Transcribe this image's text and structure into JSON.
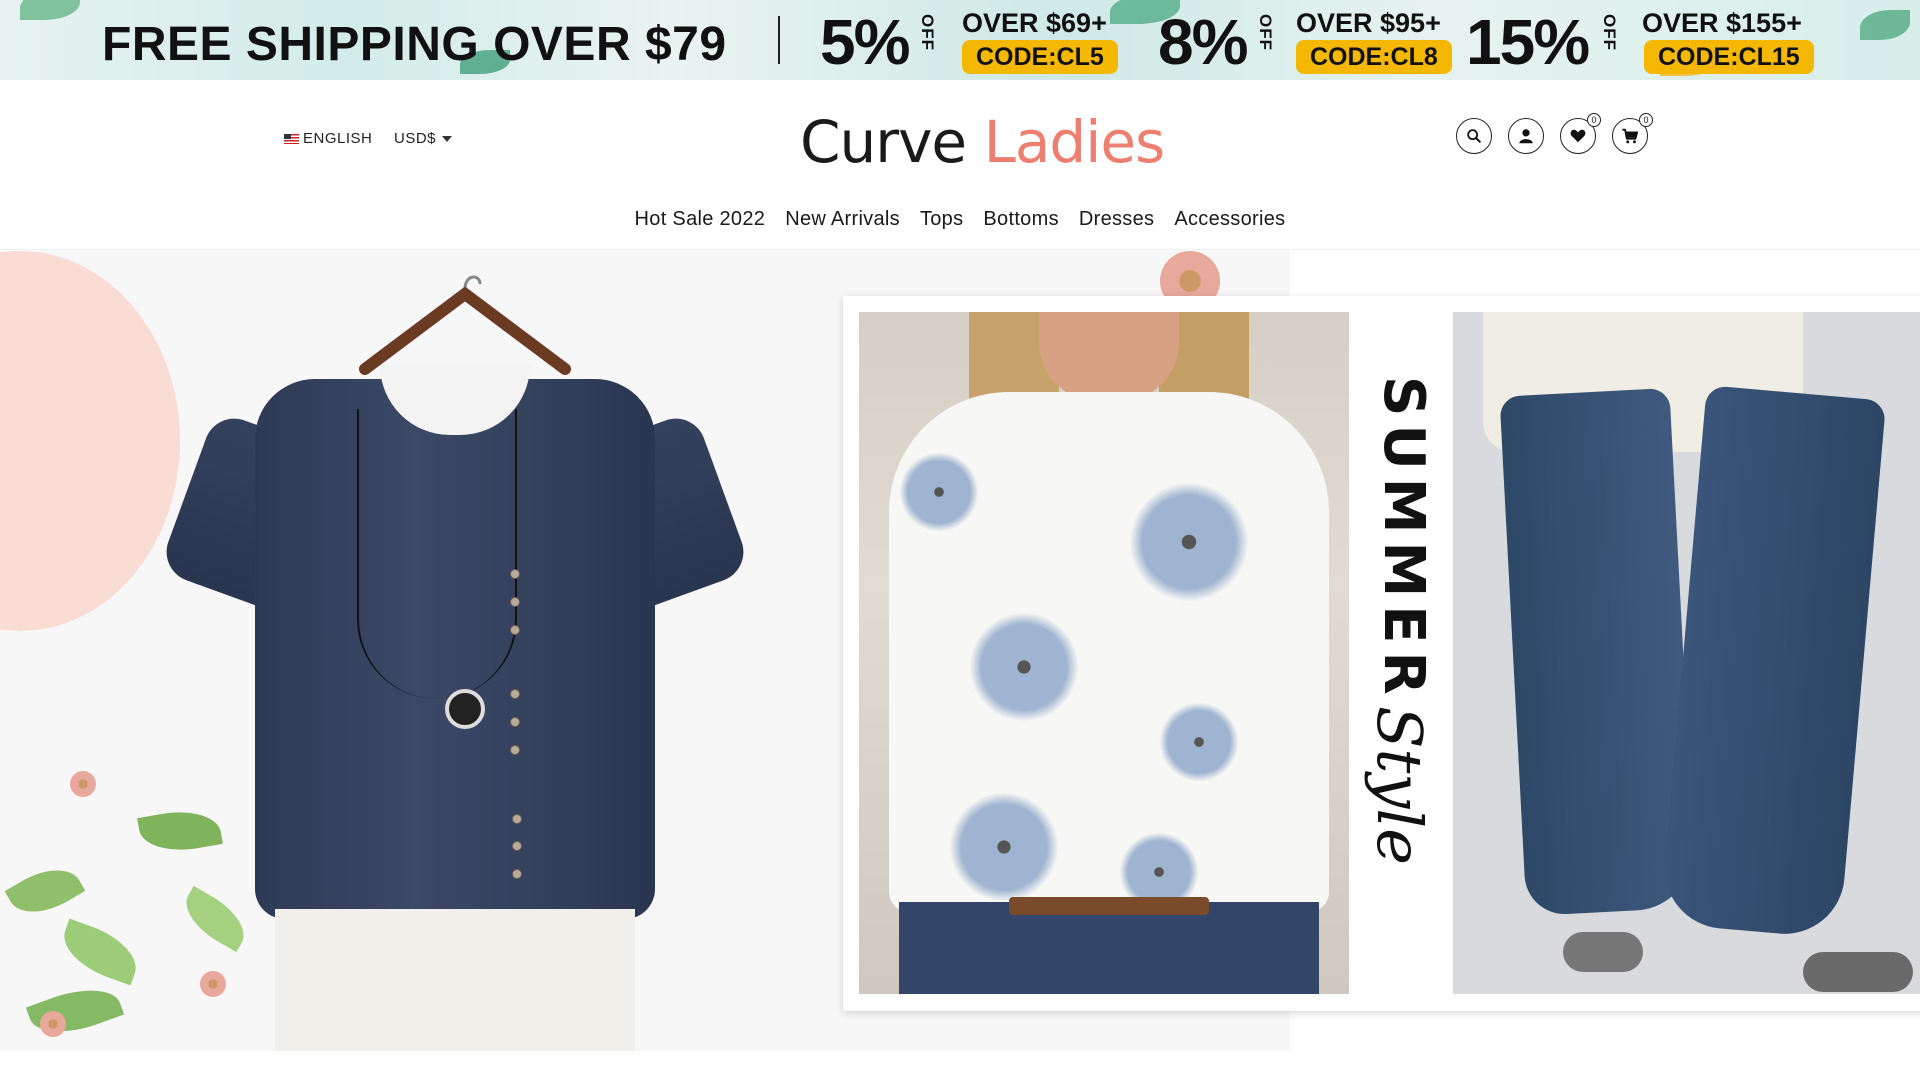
{
  "promo": {
    "shipping": "FREE SHIPPING OVER $79",
    "deals": [
      {
        "percent": "5%",
        "off": "OFF",
        "threshold": "OVER $69+",
        "code": "CODE:CL5"
      },
      {
        "percent": "8%",
        "off": "OFF",
        "threshold": "OVER $95+",
        "code": "CODE:CL8"
      },
      {
        "percent": "15%",
        "off": "OFF",
        "threshold": "OVER $155+",
        "code": "CODE:CL15"
      }
    ]
  },
  "header": {
    "language": "ENGLISH",
    "currency": "USD$",
    "logo_part1": "Curve",
    "logo_part2": "Ladies",
    "wishlist_count": "0",
    "cart_count": "0"
  },
  "nav": {
    "items": [
      "Hot Sale 2022",
      "New Arrivals",
      "Tops",
      "Bottoms",
      "Dresses",
      "Accessories"
    ]
  },
  "hero": {
    "title_word1": "SUMMER",
    "title_word2": "Style"
  },
  "colors": {
    "logo_accent": "#ec7f70",
    "code_badge": "#f5b800"
  },
  "icons": [
    "search-icon",
    "user-icon",
    "heart-icon",
    "cart-icon",
    "chevron-down-icon",
    "us-flag-icon"
  ]
}
